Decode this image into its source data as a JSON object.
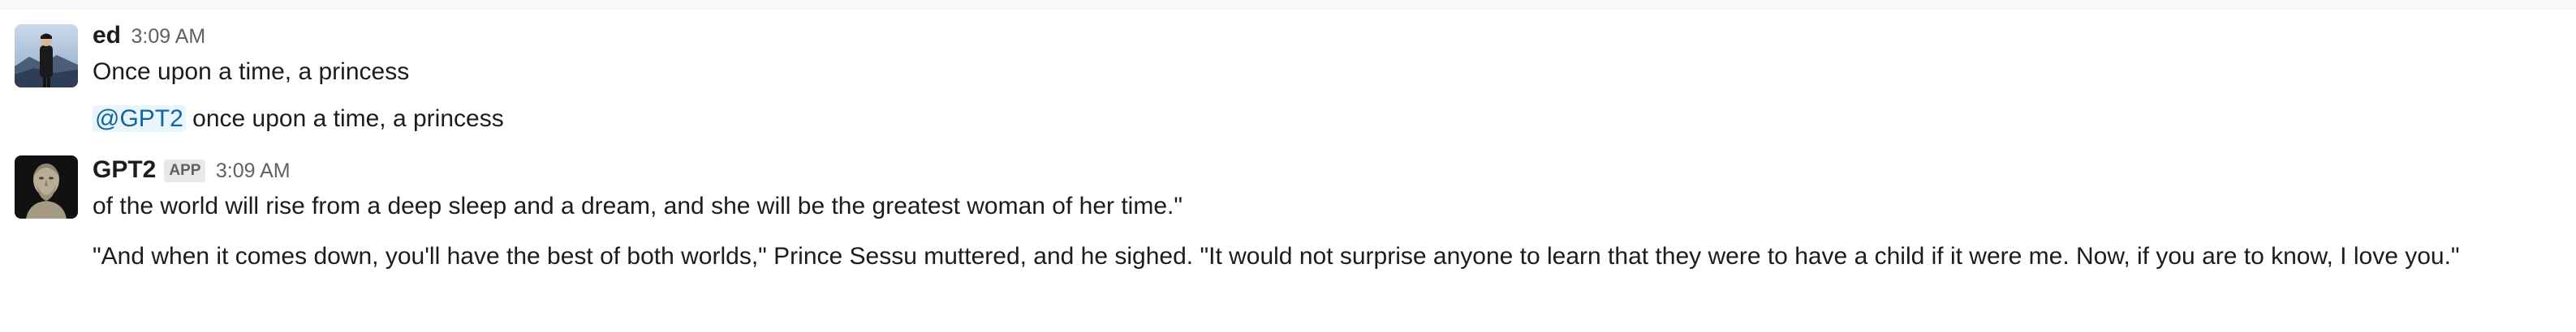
{
  "messages": [
    {
      "author": "ed",
      "time": "3:09 AM",
      "avatar_icon": "person-photo-avatar",
      "lines": [
        {
          "text": "Once upon a time, a princess"
        }
      ],
      "followups": [
        {
          "mention": "@GPT2",
          "text": " once upon a time, a princess"
        }
      ]
    },
    {
      "author": "GPT2",
      "badge": "APP",
      "time": "3:09 AM",
      "avatar_icon": "bust-statue-avatar",
      "paragraphs": [
        "of the world will rise from a deep sleep and a dream, and she will be the greatest woman of her time.\"",
        "\"And when it comes down, you'll have the best of both worlds,\" Prince Sessu muttered, and he sighed. \"It would not surprise anyone to learn that they were to have a child if it were me. Now, if you are to know, I love you.\""
      ]
    }
  ],
  "colors": {
    "mention_bg": "#e8f5fa",
    "mention_text": "#1264a3",
    "timestamp": "#616061",
    "text": "#1d1c1d"
  }
}
